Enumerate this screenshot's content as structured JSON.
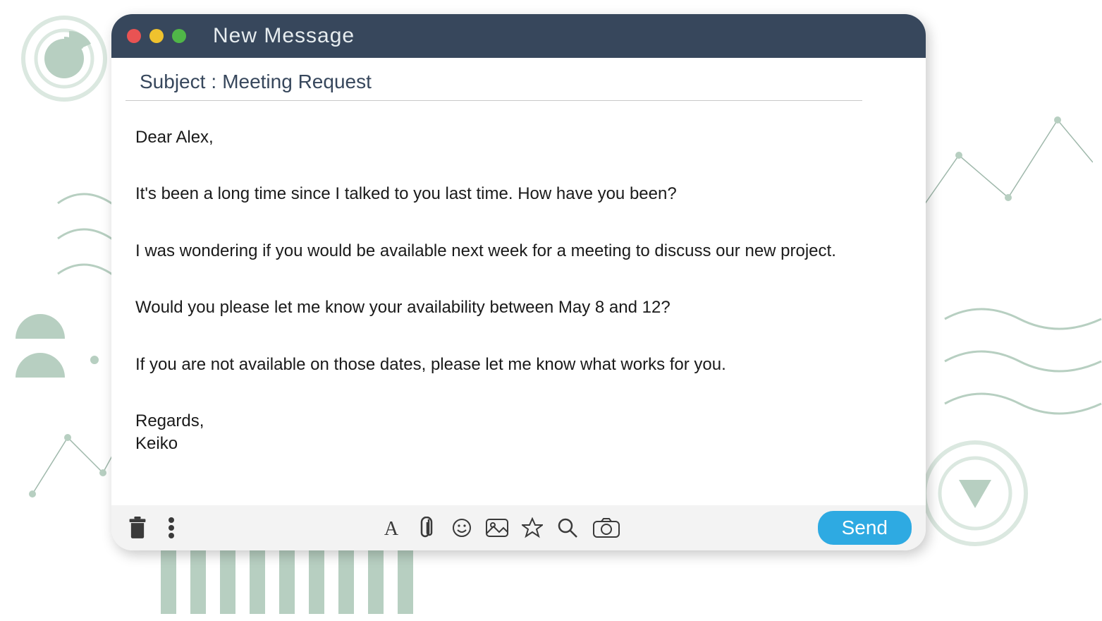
{
  "window": {
    "title": "New  Message"
  },
  "subject": {
    "label": "Subject",
    "separator": ":",
    "value": "Meeting Request"
  },
  "body": {
    "greeting": "Dear Alex,",
    "p1": "It's been a long time since I talked to you last time. How have you been?",
    "p2": "I was wondering if you would be available next week for a meeting to discuss our new project.",
    "p3": "Would you please let me know your availability between May 8 and 12?",
    "p4": "If you are not available on those dates, please let me know what works for you.",
    "signoff": "Regards,",
    "signature": "Keiko"
  },
  "toolbar": {
    "send_label": "Send"
  },
  "colors": {
    "titlebar": "#37475c",
    "send": "#2eaae2",
    "deco": "#b7cfc1"
  }
}
